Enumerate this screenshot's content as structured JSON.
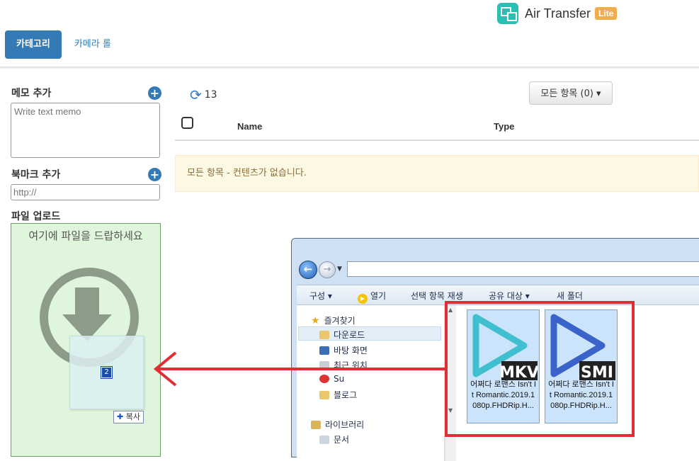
{
  "header": {
    "brand_name": "Air Transfer",
    "brand_badge": "Lite",
    "tabs": [
      {
        "label": "카테고리",
        "active": true
      },
      {
        "label": "카메라 롤",
        "active": false
      }
    ]
  },
  "sidebar": {
    "memo_label": "메모 추가",
    "memo_placeholder": "Write text memo",
    "bookmark_label": "북마크 추가",
    "bookmark_placeholder": "http://",
    "upload_label": "파일 업로드",
    "dropzone_text": "여기에 파일을 드랍하세요",
    "drag_count": "2",
    "copy_label": "복사"
  },
  "list": {
    "refresh_count": "13",
    "filter_button": "모든 항목 (0) ▾",
    "columns": [
      "Name",
      "Type"
    ],
    "empty_message": "모든 항목 - 컨텐츠가 없습니다."
  },
  "explorer": {
    "toolbar": [
      {
        "label": "구성 ▾"
      },
      {
        "label": "열기"
      },
      {
        "label": "선택 항목 재생"
      },
      {
        "label": "공유 대상 ▾"
      },
      {
        "label": "새 폴더"
      }
    ],
    "nav": [
      {
        "label": "즐겨찾기",
        "icon": "star-icon"
      },
      {
        "label": "다운로드",
        "icon": "download-folder-icon"
      },
      {
        "label": "바탕 화면",
        "icon": "desktop-icon"
      },
      {
        "label": "최근 위치",
        "icon": "recent-places-icon"
      },
      {
        "label": "Su",
        "icon": "user-icon"
      },
      {
        "label": "블로그",
        "icon": "folder-icon"
      },
      {
        "label": "라이브러리",
        "icon": "library-icon"
      },
      {
        "label": "문서",
        "icon": "documents-icon"
      }
    ],
    "files": [
      {
        "badge": "MKV",
        "name": "어쩌다 로맨스 Isn't It Romantic.2019.1080p.FHDRip.H...",
        "color": "#3fbfcf"
      },
      {
        "badge": "SMI",
        "name": "어쩌다 로맨스 Isn't It Romantic.2019.1080p.FHDRip.H...",
        "color": "#3a63c9"
      }
    ]
  },
  "colors": {
    "primary": "#337ab7",
    "badge": "#f0ad4e",
    "dropzone_bg": "#dff5dc",
    "alert_bg": "#fcf8e3",
    "highlight": "#e12e35"
  }
}
